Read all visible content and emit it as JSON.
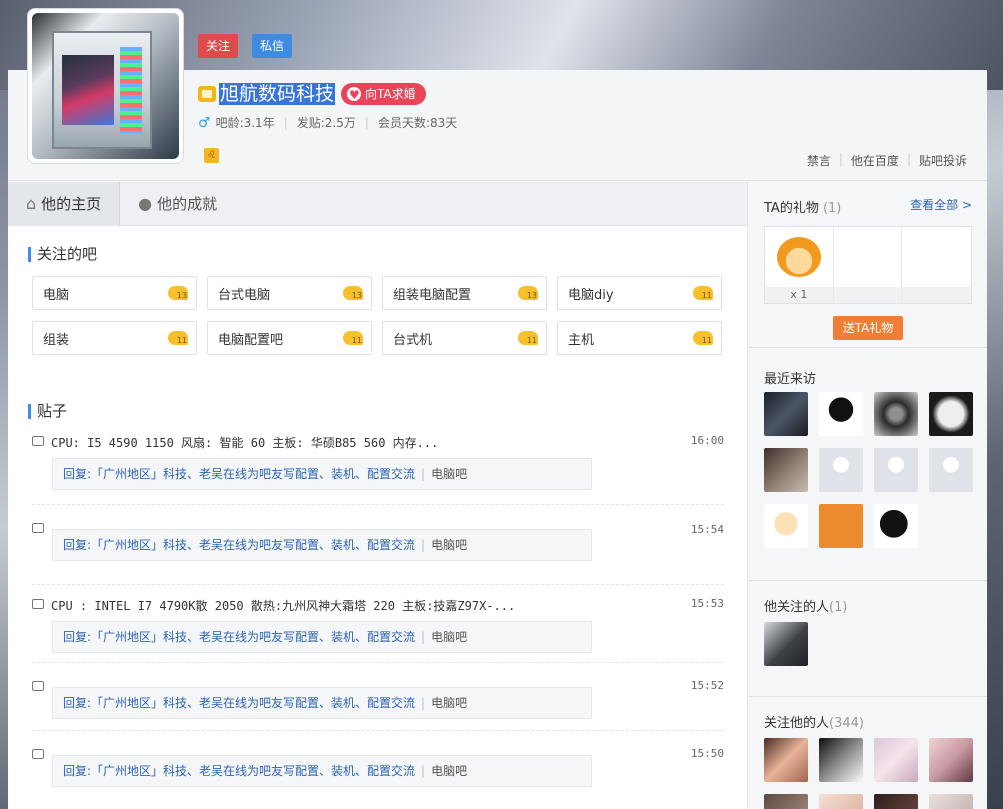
{
  "header": {
    "follow_label": "关注",
    "message_label": "私信",
    "username": "旭航数码科技",
    "love_label": "向TA求婚",
    "age_label": "吧龄:3.1年",
    "posts_label": "发贴:2.5万",
    "member_label": "会员天数:83天",
    "links": [
      "禁言",
      "他在百度",
      "贴吧投诉"
    ]
  },
  "tabs": [
    {
      "label": "他的主页"
    },
    {
      "label": "他的成就"
    }
  ],
  "followed_bars": {
    "title": "关注的吧",
    "items": [
      {
        "name": "电脑",
        "level": "13"
      },
      {
        "name": "台式电脑",
        "level": "13"
      },
      {
        "name": "组装电脑配置",
        "level": "13"
      },
      {
        "name": "电脑diy",
        "level": "11"
      },
      {
        "name": "组装",
        "level": "11"
      },
      {
        "name": "电脑配置吧",
        "level": "11"
      },
      {
        "name": "台式机",
        "level": "11"
      },
      {
        "name": "主机",
        "level": "11"
      }
    ]
  },
  "posts": {
    "title": "贴子",
    "items": [
      {
        "title": "CPU: I5 4590 1150 风扇: 智能 60 主板: 华硕B85 560 内存...",
        "time": "16:00",
        "reply": "回复:「广州地区」科技、老吴在线为吧友写配置、装机、配置交流",
        "bar": "电脑吧"
      },
      {
        "title": "",
        "time": "15:54",
        "reply": "回复:「广州地区」科技、老吴在线为吧友写配置、装机、配置交流",
        "bar": "电脑吧"
      },
      {
        "title": "CPU : INTEL I7 4790K散 2050 散热:九州风神大霜塔 220 主板:技嘉Z97X-...",
        "time": "15:53",
        "reply": "回复:「广州地区」科技、老吴在线为吧友写配置、装机、配置交流",
        "bar": "电脑吧"
      },
      {
        "title": "",
        "time": "15:52",
        "reply": "回复:「广州地区」科技、老吴在线为吧友写配置、装机、配置交流",
        "bar": "电脑吧"
      },
      {
        "title": "",
        "time": "15:50",
        "reply": "回复:「广州地区」科技、老吴在线为吧友写配置、装机、配置交流",
        "bar": "电脑吧"
      }
    ]
  },
  "sidebar": {
    "gifts": {
      "title": "TA的礼物",
      "count": "(1)",
      "view_all": "查看全部 >",
      "gift_count": "x 1",
      "send_label": "送TA礼物"
    },
    "visitors": {
      "title": "最近来访"
    },
    "following": {
      "title": "他关注的人",
      "count": "(1)"
    },
    "followers": {
      "title": "关注他的人",
      "count": "(344)"
    }
  },
  "colors": {
    "accent_blue": "#3d8ce2",
    "follow_red": "#e04a4a",
    "gift_orange": "#f07e36",
    "link_blue": "#2d64b3"
  }
}
